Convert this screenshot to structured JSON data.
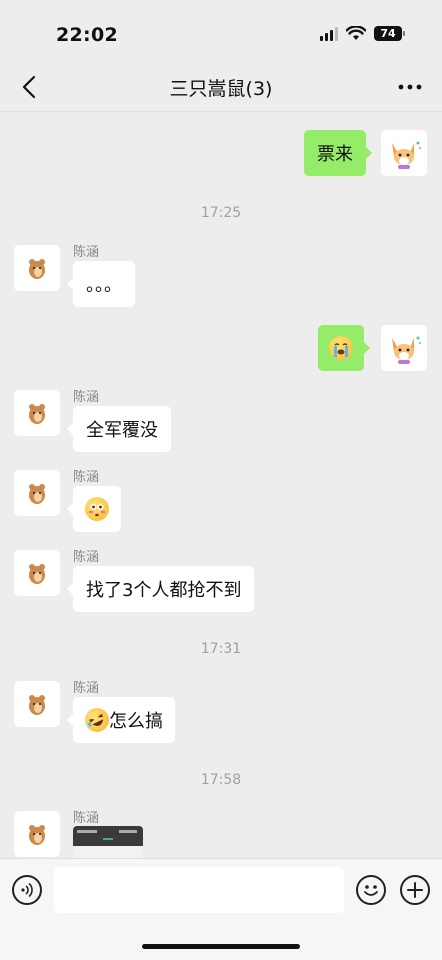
{
  "status": {
    "time": "22:02",
    "battery": "74"
  },
  "header": {
    "title": "三只嵩鼠(3)"
  },
  "messages": [
    {
      "side": "right",
      "text": "票来"
    },
    {
      "type": "time",
      "text": "17:25"
    },
    {
      "side": "left",
      "sender": "陈涵",
      "text": "。。。"
    },
    {
      "side": "right",
      "emoji": "loudly-crying-face"
    },
    {
      "side": "left",
      "sender": "陈涵",
      "text": "全军覆没"
    },
    {
      "side": "left",
      "sender": "陈涵",
      "emoji": "flushed-face"
    },
    {
      "side": "left",
      "sender": "陈涵",
      "text": "找了3个人都抢不到"
    },
    {
      "type": "time",
      "text": "17:31"
    },
    {
      "side": "left",
      "sender": "陈涵",
      "emoji": "rolling-on-floor-laughing",
      "text": "怎么搞"
    },
    {
      "type": "time",
      "text": "17:58"
    },
    {
      "side": "left",
      "sender": "陈涵",
      "type_detail": "image"
    }
  ],
  "input": {
    "placeholder": ""
  },
  "colors": {
    "self_bubble": "#95ec69",
    "background": "#ededed"
  }
}
